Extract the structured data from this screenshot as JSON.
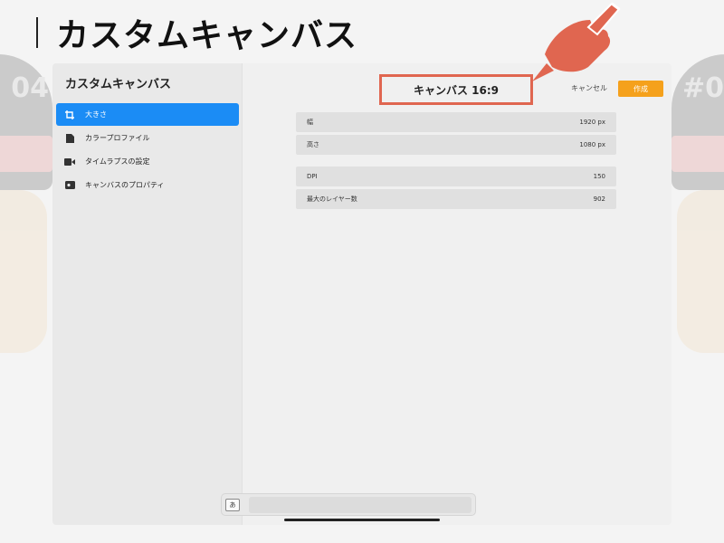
{
  "slide": {
    "heading": "カスタムキャンバス"
  },
  "decorations": {
    "left_number": "04",
    "right_number": "#0"
  },
  "app": {
    "sidebar": {
      "title": "カスタムキャンバス",
      "items": [
        {
          "label": "大きさ",
          "icon": "crop-icon",
          "active": true
        },
        {
          "label": "カラープロファイル",
          "icon": "document-icon",
          "active": false
        },
        {
          "label": "タイムラプスの設定",
          "icon": "video-camera-icon",
          "active": false
        },
        {
          "label": "キャンバスのプロパティ",
          "icon": "properties-icon",
          "active": false
        }
      ]
    },
    "header": {
      "canvas_name": "キャンバス 16:9",
      "cancel_label": "キャンセル",
      "create_label": "作成"
    },
    "size_fields": [
      {
        "label": "幅",
        "value": "1920 px"
      },
      {
        "label": "高さ",
        "value": "1080 px"
      }
    ],
    "info_fields": [
      {
        "label": "DPI",
        "value": "150"
      },
      {
        "label": "最大のレイヤー数",
        "value": "902"
      }
    ],
    "keyboard_bar": {
      "key_label": "あ"
    }
  },
  "colors": {
    "accent_blue": "#1b8cf5",
    "create_orange": "#f5a11c",
    "highlight_red": "#e06650"
  }
}
